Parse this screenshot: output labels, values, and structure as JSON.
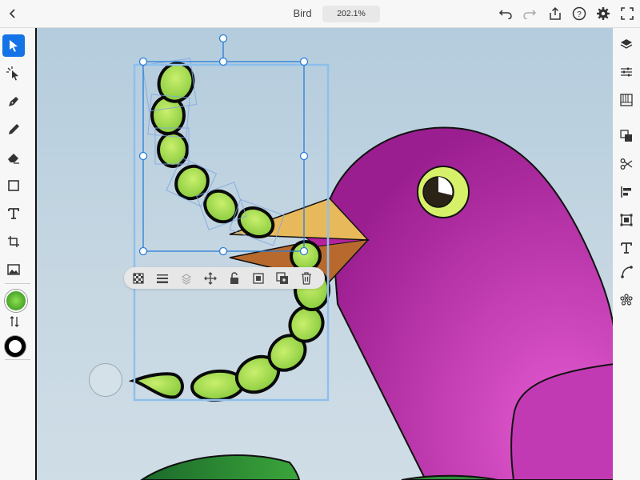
{
  "app": {
    "document_title": "Bird",
    "zoom": "202.1%"
  },
  "toolbar_top": {
    "back": "chevron-left-icon",
    "right_icons": [
      "undo-icon",
      "redo-icon",
      "share-icon",
      "help-icon",
      "settings-icon",
      "fullscreen-icon"
    ]
  },
  "tools_left": [
    {
      "name": "selection-tool",
      "icon": "arrow-icon",
      "active": true
    },
    {
      "name": "direct-selection-tool",
      "icon": "direct-select-icon"
    },
    {
      "name": "pen-tool",
      "icon": "pen-icon"
    },
    {
      "name": "pencil-tool",
      "icon": "pencil-icon"
    },
    {
      "name": "eraser-tool",
      "icon": "eraser-icon"
    },
    {
      "name": "shape-tool",
      "icon": "rectangle-icon"
    },
    {
      "name": "type-tool",
      "icon": "type-icon"
    },
    {
      "name": "crop-tool",
      "icon": "crop-icon"
    },
    {
      "name": "image-tool",
      "icon": "image-icon"
    }
  ],
  "colors": {
    "fill": "#4caf2e",
    "stroke": "#000000",
    "accent": "#1473e6",
    "bird": "#b3239c",
    "beak_top": "#e8b95a",
    "beak_bottom": "#b86a2e",
    "worm": "#9fd64c",
    "eye_ring": "#d7f06a"
  },
  "panel_right": [
    "layers-icon",
    "properties-icon",
    "libraries-icon",
    "pathfinder-icon",
    "scissors-icon",
    "align-icon",
    "transform-icon",
    "text-panel-icon",
    "bezier-icon",
    "symbols-icon"
  ],
  "context_toolbar": [
    "transparency-icon",
    "stroke-weight-icon",
    "arrange-icon",
    "move-icon",
    "unlock-icon",
    "mask-icon",
    "duplicate-icon",
    "delete-icon"
  ]
}
